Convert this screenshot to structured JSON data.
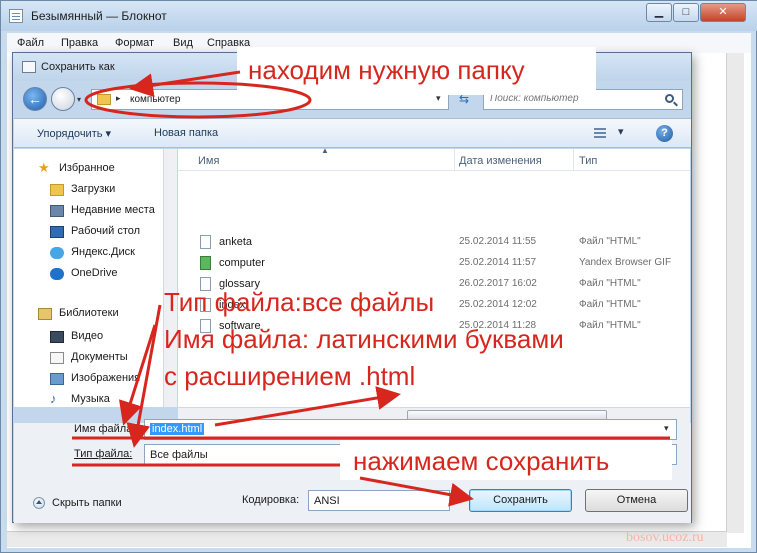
{
  "notepad": {
    "title": "Безымянный — Блокнот",
    "menu": [
      "Файл",
      "Правка",
      "Формат",
      "Вид",
      "Справка"
    ]
  },
  "dialog": {
    "title": "Сохранить как",
    "address": {
      "path": "компьютер"
    },
    "search": {
      "placeholder": "Поиск: компьютер"
    },
    "toolbar": {
      "organize": "Упорядочить",
      "new_folder": "Новая папка"
    },
    "nav": {
      "favorites_header": "Избранное",
      "favorites": [
        "Загрузки",
        "Недавние места",
        "Рабочий стол",
        "Яндекс.Диск",
        "OneDrive"
      ],
      "libraries_header": "Библиотеки",
      "libraries": [
        "Видео",
        "Документы",
        "Изображения",
        "Музыка"
      ]
    },
    "columns": {
      "name": "Имя",
      "date": "Дата изменения",
      "type": "Тип"
    },
    "files": [
      {
        "name": "anketa",
        "date": "25.02.2014 11:55",
        "type": "Файл \"HTML\""
      },
      {
        "name": "computer",
        "date": "25.02.2014 11:57",
        "type": "Yandex Browser GIF"
      },
      {
        "name": "glossary",
        "date": "26.02.2017 16:02",
        "type": "Файл \"HTML\""
      },
      {
        "name": "index",
        "date": "25.02.2014 12:02",
        "type": "Файл \"HTML\""
      },
      {
        "name": "software",
        "date": "25.02.2014 11:28",
        "type": "Файл \"HTML\""
      }
    ],
    "filename_label": "Имя файла:",
    "filename_value": "index.html",
    "filetype_label": "Тип файла:",
    "filetype_value": "Все файлы",
    "hide_folders": "Скрыть папки",
    "encoding_label": "Кодировка:",
    "encoding_value": "ANSI",
    "save_button": "Сохранить",
    "cancel_button": "Отмена"
  },
  "annotations": {
    "find_folder": "находим нужную папку",
    "file_type": "Тип файла:все файлы",
    "file_name": "Имя файла: латинскими буквами",
    "extension": "с расширением .html",
    "press_save": "нажимаем сохранить"
  },
  "watermark": "bosov.ucoz.ru",
  "colors": {
    "annotation": "#d7261e",
    "selection": "#3399ff",
    "titlebar": "#c3d7ec"
  }
}
